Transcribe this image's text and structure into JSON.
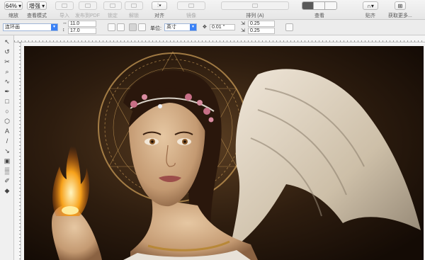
{
  "toolbar": {
    "zoom": {
      "value": "64%",
      "label": "缩放"
    },
    "view_mode": {
      "value": "增强",
      "label": "查看模式"
    },
    "import_label": "导入",
    "publish_pdf_label": "发布到PDF",
    "lock_label": "锁定",
    "unlock_label": "解锁",
    "align_label": "对齐",
    "mirror_label": "镜像",
    "arrange_label": "排列 (A)",
    "view_label": "查看",
    "snap_label": "贴齐",
    "get_more_label": "获取更多..."
  },
  "property_bar": {
    "page_preset": "连环画",
    "width": "11.0",
    "height": "17.0",
    "units_label": "单位:",
    "units_value": "英寸",
    "nudge": "0.01 \"",
    "duplicate_x": "0.25",
    "duplicate_y": "0.25"
  },
  "tools": [
    "pick-tool",
    "shape-tool",
    "crop-tool",
    "zoom-tool",
    "freehand-tool",
    "artistic-media-tool",
    "rectangle-tool",
    "ellipse-tool",
    "polygon-tool",
    "text-tool",
    "parallel-dimension-tool",
    "connector-tool",
    "drop-shadow-tool",
    "transparency-tool",
    "eyedropper-tool",
    "fill-tool"
  ],
  "tool_glyphs": [
    "↖",
    "↺",
    "✂",
    "⌕",
    "∿",
    "✒",
    "□",
    "○",
    "⬡",
    "A",
    "/",
    "↘",
    "▣",
    "▒",
    "✐",
    "◆"
  ],
  "colors": {
    "accent": "#3b82f6",
    "artwork_bg": "#2a1a0e",
    "flame": "#f7a21b",
    "halo": "#c79a55"
  }
}
